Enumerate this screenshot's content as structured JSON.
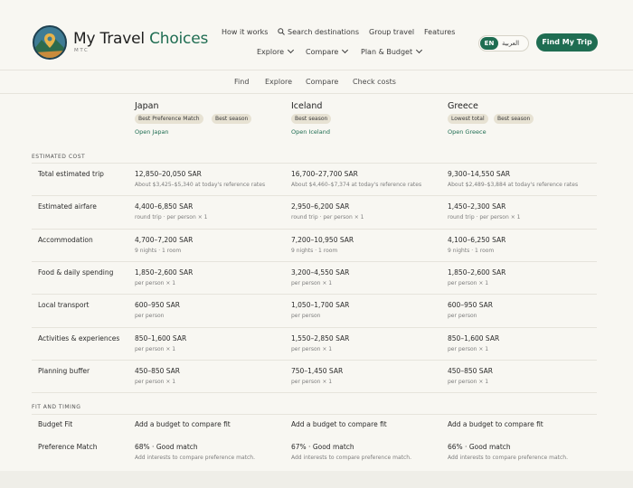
{
  "brand": {
    "name_plain": "My Travel ",
    "name_accent": "Choices",
    "sub": "MTC"
  },
  "nav": {
    "top": [
      "How it works",
      "Search destinations",
      "Group travel",
      "Features"
    ],
    "bottom": [
      "Explore",
      "Compare",
      "Plan & Budget"
    ]
  },
  "lang": {
    "en": "EN",
    "ar": "العربية"
  },
  "cta": "Find My Trip",
  "subnav": [
    "Find",
    "Explore",
    "Compare",
    "Check costs"
  ],
  "destinations": [
    {
      "name": "Japan",
      "tags": [
        "Best Preference Match",
        "Best season"
      ],
      "link": "Open Japan"
    },
    {
      "name": "Iceland",
      "tags": [
        "Best season"
      ],
      "link": "Open Iceland"
    },
    {
      "name": "Greece",
      "tags": [
        "Lowest total",
        "Best season"
      ],
      "link": "Open Greece"
    }
  ],
  "sections": {
    "cost": "ESTIMATED COST",
    "fit": "FIT AND TIMING"
  },
  "cost_rows": [
    {
      "label": "Total estimated trip",
      "cells": [
        {
          "main": "12,850–20,050 SAR",
          "sub": "About $3,425–$5,340 at today's reference rates"
        },
        {
          "main": "16,700–27,700 SAR",
          "sub": "About $4,460–$7,374 at today's reference rates"
        },
        {
          "main": "9,300–14,550 SAR",
          "sub": "About $2,489–$3,884 at today's reference rates"
        }
      ]
    },
    {
      "label": "Estimated airfare",
      "cells": [
        {
          "main": "4,400–6,850 SAR",
          "sub": "round trip · per person × 1"
        },
        {
          "main": "2,950–6,200 SAR",
          "sub": "round trip · per person × 1"
        },
        {
          "main": "1,450–2,300 SAR",
          "sub": "round trip · per person × 1"
        }
      ]
    },
    {
      "label": "Accommodation",
      "cells": [
        {
          "main": "4,700–7,200 SAR",
          "sub": "9 nights · 1 room"
        },
        {
          "main": "7,200–10,950 SAR",
          "sub": "9 nights · 1 room"
        },
        {
          "main": "4,100–6,250 SAR",
          "sub": "9 nights · 1 room"
        }
      ]
    },
    {
      "label": "Food & daily spending",
      "cells": [
        {
          "main": "1,850–2,600 SAR",
          "sub": "per person × 1"
        },
        {
          "main": "3,200–4,550 SAR",
          "sub": "per person × 1"
        },
        {
          "main": "1,850–2,600 SAR",
          "sub": "per person × 1"
        }
      ]
    },
    {
      "label": "Local transport",
      "cells": [
        {
          "main": "600–950 SAR",
          "sub": "per person"
        },
        {
          "main": "1,050–1,700 SAR",
          "sub": "per person"
        },
        {
          "main": "600–950 SAR",
          "sub": "per person"
        }
      ]
    },
    {
      "label": "Activities & experiences",
      "cells": [
        {
          "main": "850–1,600 SAR",
          "sub": "per person × 1"
        },
        {
          "main": "1,550–2,850 SAR",
          "sub": "per person × 1"
        },
        {
          "main": "850–1,600 SAR",
          "sub": "per person × 1"
        }
      ]
    },
    {
      "label": "Planning buffer",
      "cells": [
        {
          "main": "450–850 SAR",
          "sub": "per person × 1"
        },
        {
          "main": "750–1,450 SAR",
          "sub": "per person × 1"
        },
        {
          "main": "450–850 SAR",
          "sub": "per person × 1"
        }
      ]
    }
  ],
  "fit_rows": [
    {
      "label": "Budget Fit",
      "cells": [
        {
          "main": "Add a budget to compare fit",
          "sub": ""
        },
        {
          "main": "Add a budget to compare fit",
          "sub": ""
        },
        {
          "main": "Add a budget to compare fit",
          "sub": ""
        }
      ]
    },
    {
      "label": "Preference Match",
      "cells": [
        {
          "main": "68% · Good match",
          "sub": "Add interests to compare preference match."
        },
        {
          "main": "67% · Good match",
          "sub": "Add interests to compare preference match."
        },
        {
          "main": "66% · Good match",
          "sub": "Add interests to compare preference match."
        }
      ]
    }
  ],
  "colors": {
    "accent": "#1f6d52",
    "tag_bg": "#e7e2d3",
    "background": "#f8f7f2"
  },
  "icons": [
    "logo-badge-icon",
    "search-icon",
    "chevron-down-icon"
  ]
}
